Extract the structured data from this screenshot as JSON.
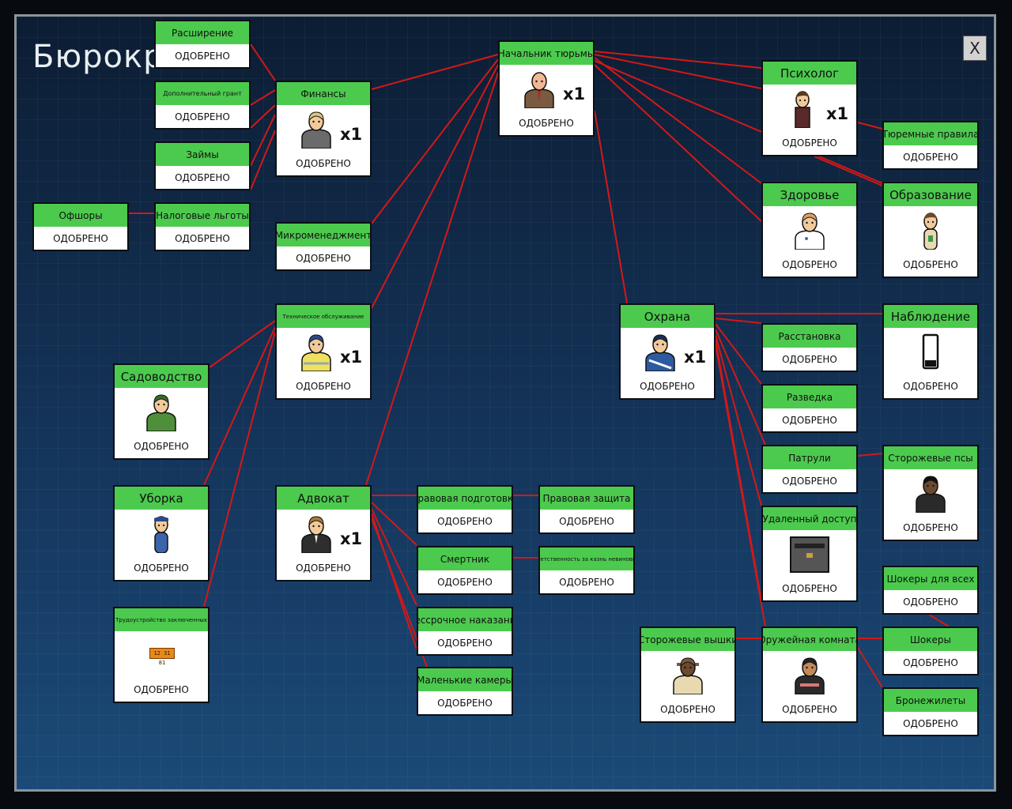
{
  "title": "Бюрокра",
  "close_label": "X",
  "status_label": "ОДОБРЕНО",
  "nodes": {
    "expansion": {
      "title": "Расширение"
    },
    "extra_grant": {
      "title": "Дополнительный грант"
    },
    "loans": {
      "title": "Займы"
    },
    "tax_breaks": {
      "title": "Налоговые льготы"
    },
    "offshore": {
      "title": "Офшоры"
    },
    "finance": {
      "title": "Финансы",
      "count": "x1"
    },
    "micromanagement": {
      "title": "Микроменеджмент"
    },
    "warden": {
      "title": "Начальник тюрьмы",
      "count": "x1"
    },
    "psychologist": {
      "title": "Психолог",
      "count": "x1"
    },
    "prison_rules": {
      "title": "Тюремные правила"
    },
    "health": {
      "title": "Здоровье"
    },
    "education": {
      "title": "Образование"
    },
    "maintenance": {
      "title": "Техническое обслуживание",
      "count": "x1"
    },
    "gardening": {
      "title": "Садоводство"
    },
    "cleaning": {
      "title": "Уборка"
    },
    "prisoner_labour": {
      "title": "Трудоустройство заключенных"
    },
    "lawyer": {
      "title": "Адвокат",
      "count": "x1"
    },
    "legal_prep": {
      "title": "Правовая подготовка"
    },
    "legal_defense": {
      "title": "Правовая защита"
    },
    "death_row": {
      "title": "Смертник"
    },
    "execution_liability": {
      "title": "Ответственность за казнь невиновных"
    },
    "life_sentence": {
      "title": "Бессрочное наказание"
    },
    "small_cells": {
      "title": "Маленькие камеры"
    },
    "security": {
      "title": "Охрана",
      "count": "x1"
    },
    "surveillance": {
      "title": "Наблюдение"
    },
    "deployment": {
      "title": "Расстановка"
    },
    "intelligence": {
      "title": "Разведка"
    },
    "patrols": {
      "title": "Патрули"
    },
    "guard_dogs": {
      "title": "Сторожевые псы"
    },
    "remote_access": {
      "title": "Удаленный доступ"
    },
    "tasers_for_all": {
      "title": "Шокеры для всех"
    },
    "tasers": {
      "title": "Шокеры"
    },
    "body_armour": {
      "title": "Бронежилеты"
    },
    "armoury": {
      "title": "Оружейная комната"
    },
    "guard_towers": {
      "title": "Сторожевые вышки"
    }
  },
  "badge_text": "12 31 81",
  "colors": {
    "header_green": "#4cca4e",
    "link_red": "#d41818",
    "approved_bg": "#ffffff"
  }
}
